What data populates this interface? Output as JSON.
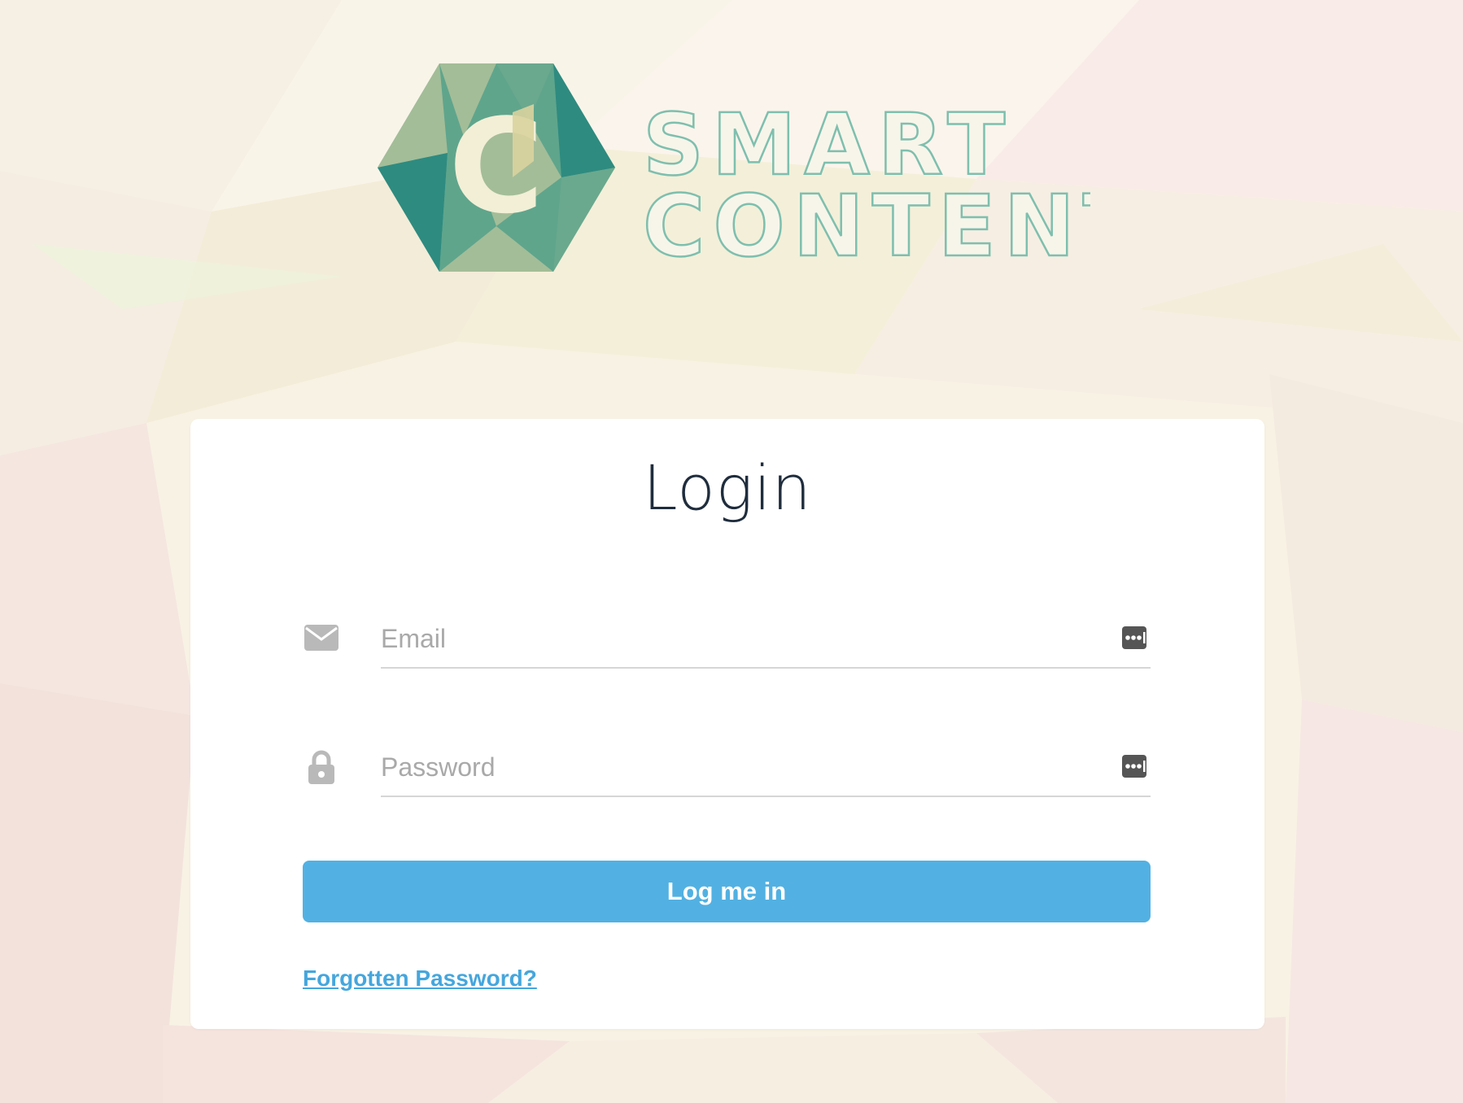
{
  "brand": {
    "name_line1": "SMART",
    "name_line2": "CONTENT",
    "logo_letter": "C",
    "colors": {
      "teal_dark": "#2e8b80",
      "teal_mid": "#5fa58c",
      "sage": "#a3bd98",
      "cream": "#ddd5a2",
      "outline_text": "#7ebfae"
    }
  },
  "login": {
    "title": "Login",
    "email": {
      "placeholder": "Email",
      "value": "",
      "icon": "envelope-icon"
    },
    "password": {
      "placeholder": "Password",
      "value": "",
      "icon": "lock-icon"
    },
    "password_manager_icon": "password-manager-icon",
    "submit_label": "Log me in",
    "forgot_label": "Forgotten Password?"
  },
  "theme": {
    "button_color": "#52b1e2",
    "link_color": "#45a6dd",
    "title_color": "#1f2d3d",
    "placeholder_color": "#a9a9a9",
    "underline_color": "#d6d6d6"
  }
}
